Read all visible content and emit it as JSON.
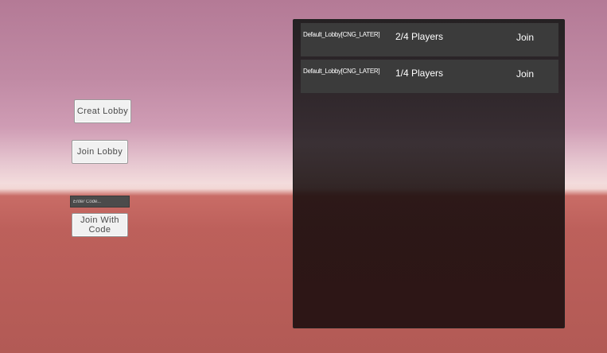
{
  "menu": {
    "create_lobby_label": "Creat Lobby",
    "join_lobby_label": "Join Lobby",
    "code_placeholder": "Enter Code...",
    "code_value": "",
    "join_with_code_label": "Join With Code"
  },
  "lobbies": [
    {
      "name": "Default_Lobby[CNG_LATER]",
      "players": "2/4 Players",
      "join_label": "Join"
    },
    {
      "name": "Default_Lobby[CNG_LATER]",
      "players": "1/4 Players",
      "join_label": "Join"
    }
  ],
  "colors": {
    "sky_top": "#b47a96",
    "horizon": "#f3dcdc",
    "ground": "#b25a55",
    "panel": "#1a1a1a",
    "row": "#3b3b3b",
    "button": "#f1f1f1"
  }
}
